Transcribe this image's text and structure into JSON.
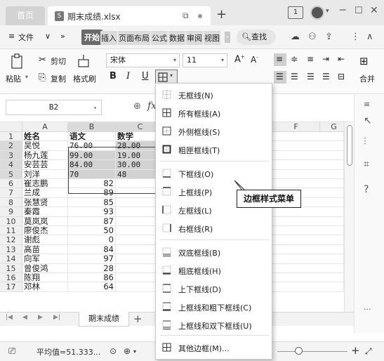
{
  "titlebar": {
    "home_tab": "首页",
    "file_tab": "期末成绩.xlsx",
    "file_icon": "S",
    "badge": "1"
  },
  "menubar": {
    "hamburger": "≡",
    "file_menu": "文件",
    "more": "»",
    "start_tab": "开始",
    "tabs": [
      "插入",
      "页面布局",
      "公式",
      "数据",
      "审阅",
      "视图"
    ],
    "search": "查找"
  },
  "ribbon": {
    "paste": "粘贴",
    "cut": "剪切",
    "copy": "复制",
    "format_painter": "格式刷",
    "font_name": "宋体",
    "font_size": "11",
    "bold": "B",
    "italic": "I",
    "underline": "U",
    "merge": "合并"
  },
  "formula": {
    "cell_ref": "B2",
    "fx": "fx"
  },
  "grid": {
    "columns": [
      "A",
      "B",
      "C"
    ],
    "column_f": "F",
    "column_g": "G",
    "row_numbers": [
      "1",
      "2",
      "3",
      "4",
      "5",
      "6",
      "7",
      "8",
      "9",
      "10",
      "11",
      "12",
      "13",
      "14",
      "15",
      "16",
      "17"
    ],
    "rows": [
      {
        "a": "姓名",
        "b": "语文",
        "c": "数学"
      },
      {
        "a": "吴悦",
        "b": "76.00",
        "c": "28.00"
      },
      {
        "a": "杨九莲",
        "b": "99.00",
        "c": "19.00"
      },
      {
        "a": "安芸芸",
        "b": "84.00",
        "c": "30.00"
      },
      {
        "a": "刘洋",
        "b": "70",
        "c": "48"
      },
      {
        "a": "崔志鹏",
        "b": "82",
        "c": ""
      },
      {
        "a": "兰成",
        "b": "89",
        "c": ""
      },
      {
        "a": "张慧贤",
        "b": "85",
        "c": ""
      },
      {
        "a": "秦霞",
        "b": "93",
        "c": ""
      },
      {
        "a": "莫岚岚",
        "b": "87",
        "c": ""
      },
      {
        "a": "廖俊杰",
        "b": "50",
        "c": ""
      },
      {
        "a": "谢彪",
        "b": "0",
        "c": ""
      },
      {
        "a": "高苗",
        "b": "84",
        "c": ""
      },
      {
        "a": "向军",
        "b": "97",
        "c": ""
      },
      {
        "a": "曾俊鸿",
        "b": "28",
        "c": ""
      },
      {
        "a": "陈翔",
        "b": "86",
        "c": ""
      },
      {
        "a": "邓林",
        "b": "64",
        "c": ""
      }
    ]
  },
  "sheet": {
    "tab_name": "期末成绩",
    "add": "+"
  },
  "statusbar": {
    "average": "平均值=51.333...",
    "zoom_plus": "+"
  },
  "border_menu": {
    "items": [
      {
        "label": "无框线(N)",
        "icon": "no-border-icon"
      },
      {
        "label": "所有框线(A)",
        "icon": "all-borders-icon"
      },
      {
        "label": "外侧框线(S)",
        "icon": "outside-borders-icon"
      },
      {
        "label": "粗匣框线(T)",
        "icon": "thick-box-border-icon"
      },
      {
        "label": "下框线(O)",
        "icon": "bottom-border-icon"
      },
      {
        "label": "上框线(P)",
        "icon": "top-border-icon"
      },
      {
        "label": "左框线(L)",
        "icon": "left-border-icon"
      },
      {
        "label": "右框线(R)",
        "icon": "right-border-icon"
      },
      {
        "label": "双底框线(B)",
        "icon": "double-bottom-border-icon"
      },
      {
        "label": "粗底框线(H)",
        "icon": "thick-bottom-border-icon"
      },
      {
        "label": "上下框线(D)",
        "icon": "top-bottom-border-icon"
      },
      {
        "label": "上框线和粗下框线(C)",
        "icon": "top-thick-bottom-border-icon"
      },
      {
        "label": "上框线和双下框线(U)",
        "icon": "top-double-bottom-border-icon"
      },
      {
        "label": "其他边框(M)...",
        "icon": "more-borders-icon"
      }
    ]
  },
  "callout": {
    "text": "边框样式菜单"
  }
}
